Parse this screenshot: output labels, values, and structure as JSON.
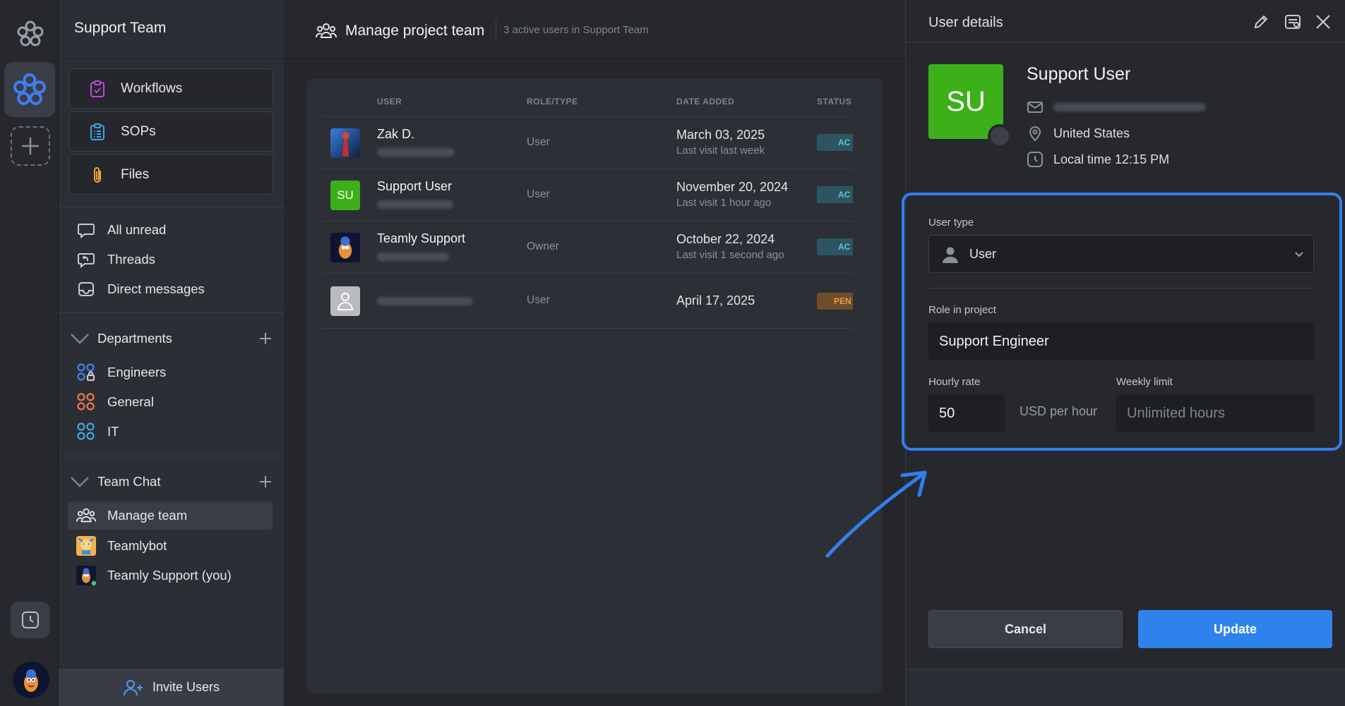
{
  "sidebar": {
    "title": "Support Team",
    "tools": [
      {
        "label": "Workflows",
        "icon": "clipboard-check-icon"
      },
      {
        "label": "SOPs",
        "icon": "list-clipboard-icon"
      },
      {
        "label": "Files",
        "icon": "paperclip-icon"
      }
    ],
    "nav": [
      {
        "label": "All unread",
        "icon": "chat-bubble-icon"
      },
      {
        "label": "Threads",
        "icon": "thread-reply-icon"
      },
      {
        "label": "Direct messages",
        "icon": "inbox-icon"
      }
    ],
    "departments": {
      "title": "Departments",
      "items": [
        {
          "label": "Engineers",
          "icon": "locked-group-icon"
        },
        {
          "label": "General",
          "icon": "group-icon"
        },
        {
          "label": "IT",
          "icon": "group-icon"
        }
      ]
    },
    "team_chat": {
      "title": "Team Chat",
      "items": [
        {
          "label": "Manage team",
          "icon": "people-icon"
        },
        {
          "label": "Teamlybot",
          "icon": "bot-avatar"
        },
        {
          "label": "Teamly Support (you)",
          "icon": "user-avatar"
        }
      ]
    },
    "invite_label": "Invite Users"
  },
  "main": {
    "title": "Manage project team",
    "subtitle": "3 active users in Support Team",
    "columns": [
      "USER",
      "ROLE/TYPE",
      "DATE ADDED",
      "STATUS"
    ],
    "rows": [
      {
        "name": "Zak D.",
        "role": "User",
        "date": "March 03, 2025",
        "visit": "Last visit last week",
        "status": "AC"
      },
      {
        "name": "Support User",
        "avatar_text": "SU",
        "role": "User",
        "date": "November 20, 2024",
        "visit": "Last visit 1 hour ago",
        "status": "AC"
      },
      {
        "name": "Teamly Support",
        "role": "Owner",
        "date": "October 22, 2024",
        "visit": "Last visit 1 second ago",
        "status": "AC"
      },
      {
        "name": "",
        "role": "User",
        "date": "April 17, 2025",
        "visit": "",
        "status": "PEN"
      }
    ]
  },
  "panel": {
    "title": "User details",
    "avatar_text": "SU",
    "user_name": "Support User",
    "location": "United States",
    "local_time": "Local time 12:15 PM",
    "user_type_label": "User type",
    "user_type_value": "User",
    "role_label": "Role in project",
    "role_value": "Support Engineer",
    "hourly_label": "Hourly rate",
    "hourly_value": "50",
    "hourly_unit": "USD per hour",
    "weekly_label": "Weekly limit",
    "weekly_placeholder": "Unlimited hours",
    "cancel_label": "Cancel",
    "update_label": "Update"
  },
  "colors": {
    "accent": "#2e82ec",
    "avatar_green": "#3cb019",
    "status_active": "#5ec5d8",
    "status_pending": "#f09a3f"
  }
}
